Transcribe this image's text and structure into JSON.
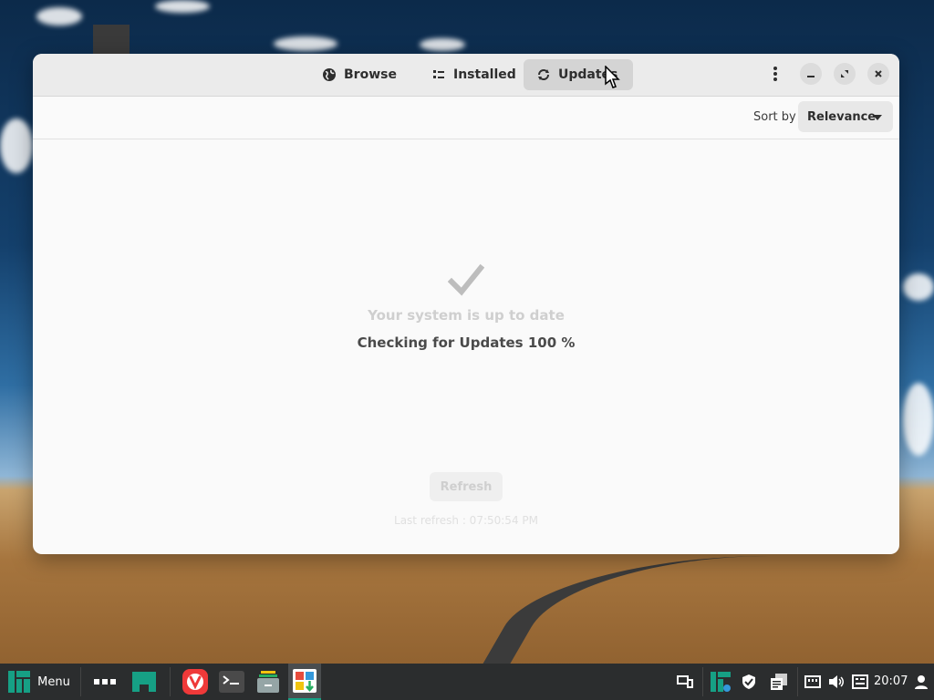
{
  "window": {
    "tabs": [
      {
        "label": "Browse",
        "icon": "globe-icon"
      },
      {
        "label": "Installed",
        "icon": "list-icon"
      },
      {
        "label": "Updates",
        "icon": "refresh-icon",
        "active": true
      }
    ],
    "sort": {
      "label": "Sort by",
      "value": "Relevance"
    },
    "status": {
      "icon": "checkmark-icon",
      "headline": "Your system is up to date",
      "progress_text": "Checking for Updates 100 %"
    },
    "refresh_label": "Refresh",
    "last_refresh": "Last refresh : 07:50:54 PM"
  },
  "taskbar": {
    "menu_label": "Menu",
    "clock": "20:07",
    "apps": [
      "workspace-switcher-icon",
      "manjaro-icon",
      "vivaldi-icon",
      "terminal-icon",
      "file-manager-icon",
      "software-center-icon"
    ],
    "tray": [
      "display-icon",
      "manjaro-settings-icon",
      "shield-icon",
      "clipboard-icon",
      "network-icon",
      "volume-icon",
      "keyboard-icon",
      "user-icon"
    ]
  },
  "colors": {
    "accent_green": "#16a085",
    "vivaldi_red": "#ef3939",
    "window_bg": "#fafafa",
    "taskbar_bg": "#2b2d2e"
  }
}
